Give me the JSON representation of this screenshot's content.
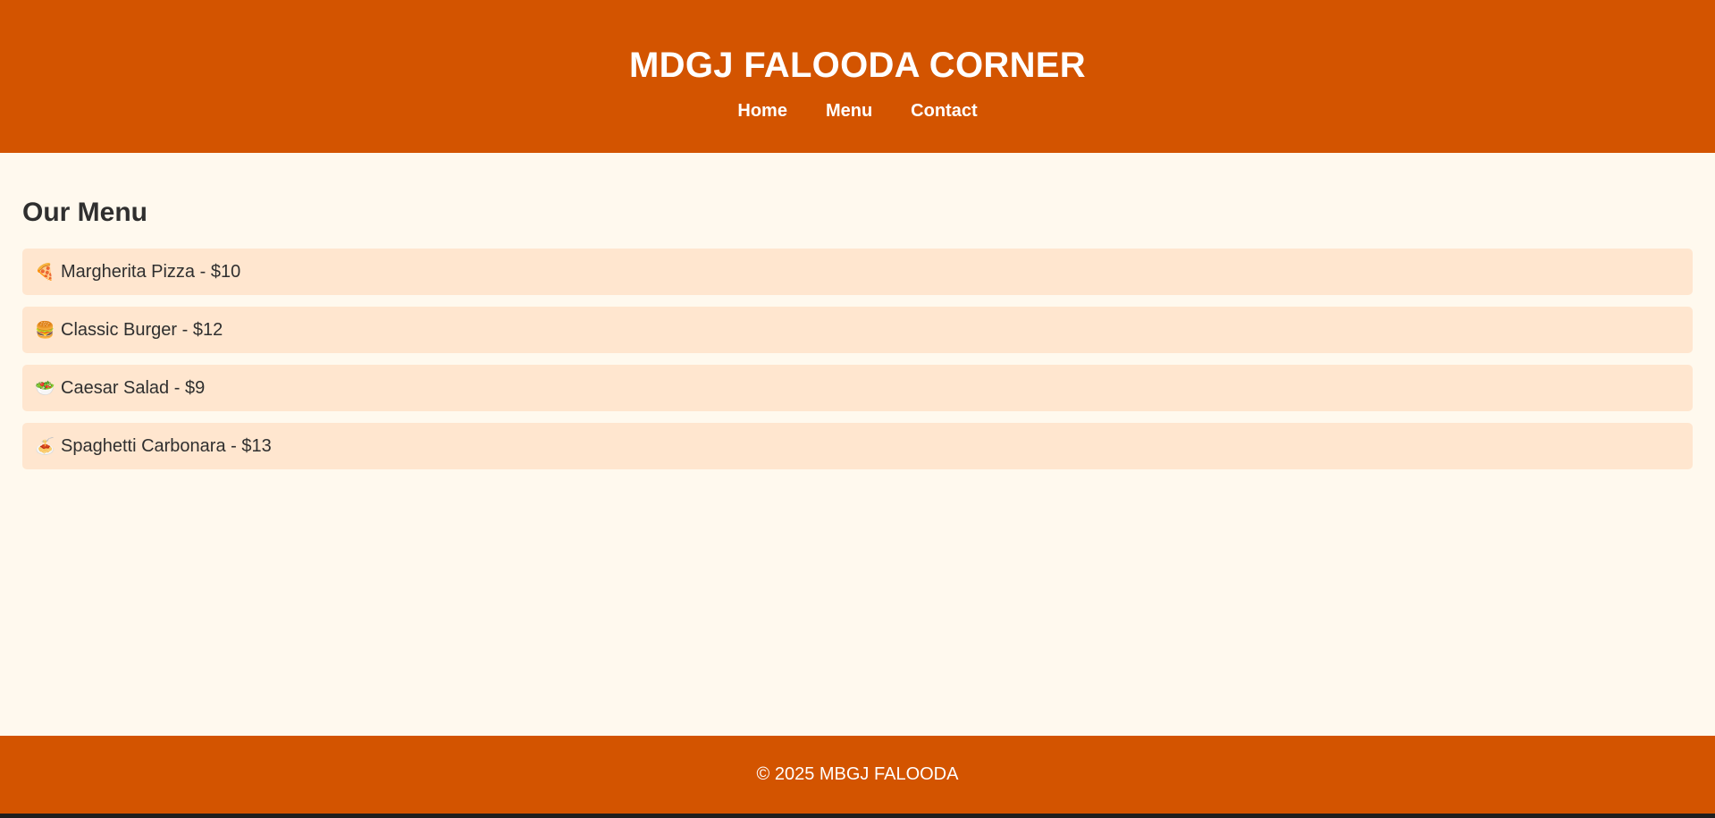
{
  "header": {
    "title": "MDGJ FALOODA CORNER",
    "nav": [
      {
        "label": "Home"
      },
      {
        "label": "Menu"
      },
      {
        "label": "Contact"
      }
    ]
  },
  "menu": {
    "heading": "Our Menu",
    "items": [
      {
        "emoji": "🍕",
        "icon": "pizza-icon",
        "name": "Margherita Pizza",
        "price": "$10"
      },
      {
        "emoji": "🍔",
        "icon": "burger-icon",
        "name": "Classic Burger",
        "price": "$12"
      },
      {
        "emoji": "🥗",
        "icon": "salad-icon",
        "name": "Caesar Salad",
        "price": "$9"
      },
      {
        "emoji": "🍝",
        "icon": "spaghetti-icon",
        "name": "Spaghetti Carbonara",
        "price": "$13"
      }
    ]
  },
  "footer": {
    "text": "© 2025 MBGJ FALOODA"
  },
  "colors": {
    "brand": "#d35400",
    "background": "#fff9ee",
    "item_background": "#ffe6cf",
    "text": "#2f2f2f"
  }
}
